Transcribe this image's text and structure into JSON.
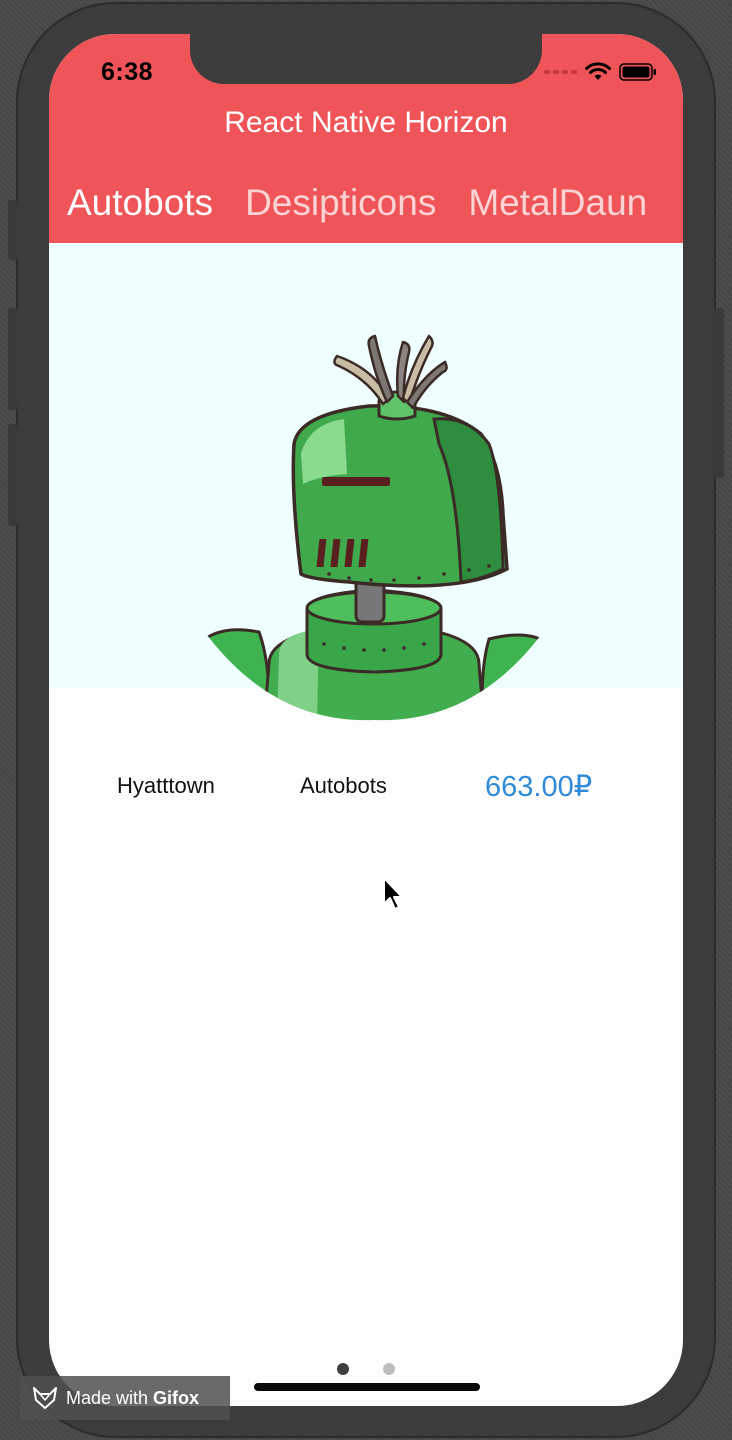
{
  "status_bar": {
    "time": "6:38"
  },
  "header": {
    "title": "React Native Horizon",
    "tabs": [
      {
        "label": "Autobots",
        "active": true
      },
      {
        "label": "Desipticons",
        "active": false
      },
      {
        "label": "MetalDaun",
        "active": false
      }
    ],
    "color": "#ef5558"
  },
  "card": {
    "image_icon": "green-robot-illustration",
    "location": "Hyatttown",
    "faction": "Autobots",
    "price": "663.00₽",
    "price_color": "#2f8bd8"
  },
  "pager": {
    "page_count": 2,
    "current_page": 1
  },
  "watermark": {
    "prefix": "Made with ",
    "brand": "Gifox"
  }
}
